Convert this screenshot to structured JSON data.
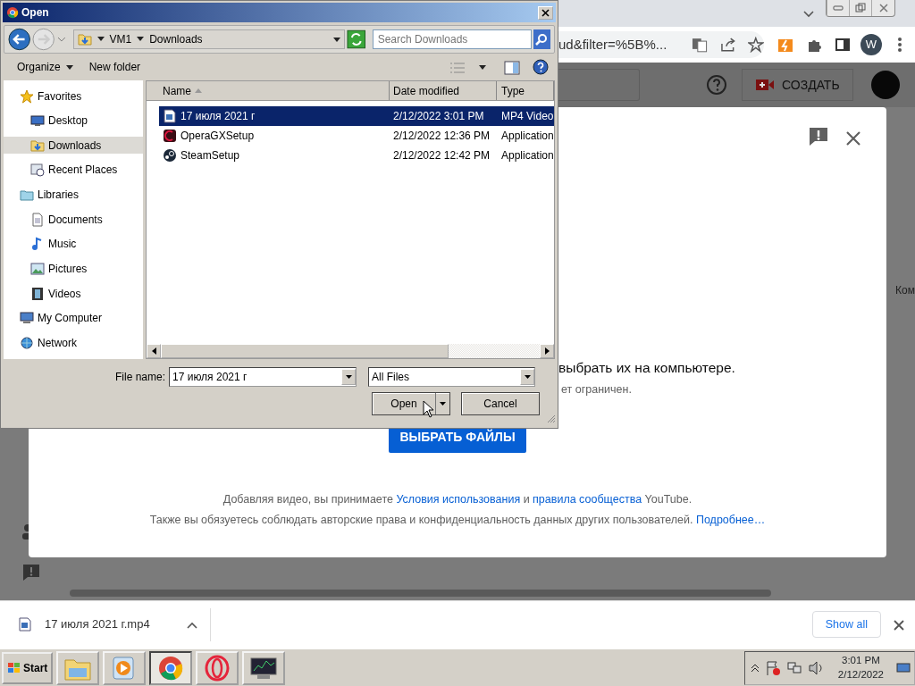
{
  "browser": {
    "url_fragment": "ud&filter=%5B%...",
    "profile_initial": "W"
  },
  "studio": {
    "create_button": "СОЗДАТЬ",
    "side_label": "Ком"
  },
  "upload_modal": {
    "prompt": "выбрать их на компьютере.",
    "note": "ет ограничен.",
    "select_button": "ВЫБРАТЬ ФАЙЛЫ",
    "terms": [
      [
        {
          "kind": "text",
          "text": "Добавляя видео, вы принимаете "
        },
        {
          "kind": "link",
          "text": "Условия использования"
        },
        {
          "kind": "text",
          "text": " и "
        },
        {
          "kind": "link",
          "text": "правила сообщества"
        },
        {
          "kind": "text",
          "text": " YouTube."
        }
      ],
      [
        {
          "kind": "text",
          "text": "Также вы обязуетесь соблюдать авторские права и конфиденциальность данных других пользователей. "
        },
        {
          "kind": "link",
          "text": "Подробнее…"
        }
      ]
    ]
  },
  "dialog": {
    "title": "Open",
    "breadcrumb": [
      "VM1",
      "Downloads"
    ],
    "search": {
      "placeholder": "Search Downloads"
    },
    "toolbar": [
      "Organize",
      "New folder"
    ],
    "nav": [
      {
        "label": "Favorites",
        "kind": "star",
        "selected": false,
        "children": [
          {
            "label": "Desktop",
            "kind": "desktop",
            "selected": false
          },
          {
            "label": "Downloads",
            "kind": "downloads",
            "selected": true
          },
          {
            "label": "Recent Places",
            "kind": "recent",
            "selected": false
          }
        ]
      },
      {
        "label": "Libraries",
        "kind": "library",
        "selected": false,
        "children": [
          {
            "label": "Documents",
            "kind": "document",
            "selected": false
          },
          {
            "label": "Music",
            "kind": "music",
            "selected": false
          },
          {
            "label": "Pictures",
            "kind": "pictures",
            "selected": false
          },
          {
            "label": "Videos",
            "kind": "videos",
            "selected": false
          }
        ]
      },
      {
        "label": "My Computer",
        "kind": "computer",
        "selected": false
      },
      {
        "label": "Network",
        "kind": "network",
        "selected": false
      }
    ],
    "columns": [
      "Name",
      "Date modified",
      "Type"
    ],
    "rows": [
      {
        "name": "17 июля 2021 г",
        "date": "2/12/2022 3:01 PM",
        "type": "MP4 Video",
        "kind": "video",
        "selected": true
      },
      {
        "name": "OperaGXSetup",
        "date": "2/12/2022 12:36 PM",
        "type": "Application",
        "kind": "redapp",
        "selected": false
      },
      {
        "name": "SteamSetup",
        "date": "2/12/2022 12:42 PM",
        "type": "Application",
        "kind": "globeapp",
        "selected": false
      }
    ],
    "file_name_label": "File name:",
    "file_name": "17 июля 2021 г",
    "file_type": "All Files",
    "buttons": [
      "Open",
      "Cancel"
    ]
  },
  "download_bar": {
    "file": "17 июля 2021 г.mp4",
    "show_all": "Show all"
  },
  "taskbar": {
    "start": "Start",
    "apps": [
      {
        "kind": "folder",
        "selected": false
      },
      {
        "kind": "player",
        "selected": false
      },
      {
        "kind": "browser",
        "selected": true
      },
      {
        "kind": "ring",
        "selected": false
      },
      {
        "kind": "monitor",
        "selected": false
      }
    ],
    "time": "3:01 PM",
    "date": "2/12/2022"
  }
}
